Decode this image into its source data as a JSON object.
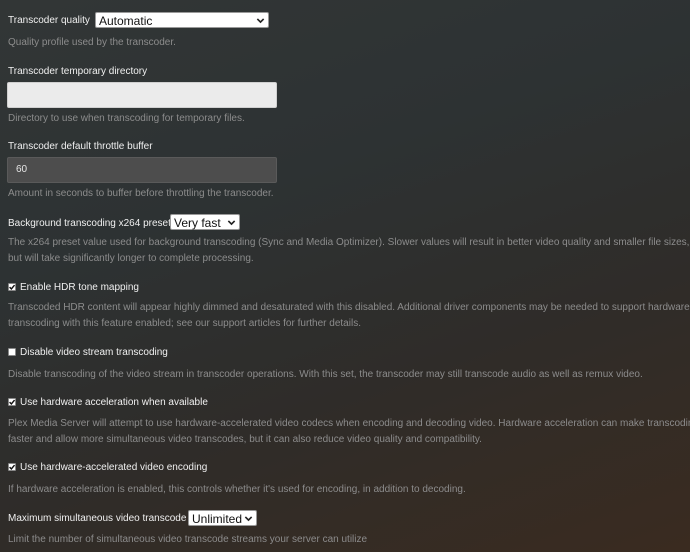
{
  "transcoder_quality": {
    "label": "Transcoder quality",
    "value": "Automatic",
    "help": "Quality profile used by the transcoder."
  },
  "temp_directory": {
    "label": "Transcoder temporary directory",
    "value": "",
    "help": "Directory to use when transcoding for temporary files."
  },
  "throttle_buffer": {
    "label": "Transcoder default throttle buffer",
    "value": "60",
    "help": "Amount in seconds to buffer before throttling the transcoder."
  },
  "x264_preset": {
    "label": "Background transcoding x264 preset",
    "value": "Very fast",
    "help_line1": "The x264 preset value used for background transcoding (Sync and Media Optimizer). Slower values will result in better video quality and smaller file sizes,",
    "help_line2": "but will take significantly longer to complete processing."
  },
  "hdr_tone_mapping": {
    "label": "Enable HDR tone mapping",
    "checked": true,
    "help_line1": "Transcoded HDR content will appear highly dimmed and desaturated with this disabled. Additional driver components may be needed to support hardware",
    "help_line2": "transcoding with this feature enabled; see our support articles for further details."
  },
  "disable_video_transcoding": {
    "label": "Disable video stream transcoding",
    "checked": false,
    "help": "Disable transcoding of the video stream in transcoder operations. With this set, the transcoder may still transcode audio as well as remux video."
  },
  "hardware_acceleration": {
    "label": "Use hardware acceleration when available",
    "checked": true,
    "help_line1": "Plex Media Server will attempt to use hardware-accelerated video codecs when encoding and decoding video. Hardware acceleration can make transcoding",
    "help_line2": "faster and allow more simultaneous video transcodes, but it can also reduce video quality and compatibility."
  },
  "hardware_encoding": {
    "label": "Use hardware-accelerated video encoding",
    "checked": true,
    "help": "If hardware acceleration is enabled, this controls whether it's used for encoding, in addition to decoding."
  },
  "max_simultaneous": {
    "label": "Maximum simultaneous video transcode",
    "value": "Unlimited",
    "help": "Limit the number of simultaneous video transcode streams your server can utilize"
  }
}
